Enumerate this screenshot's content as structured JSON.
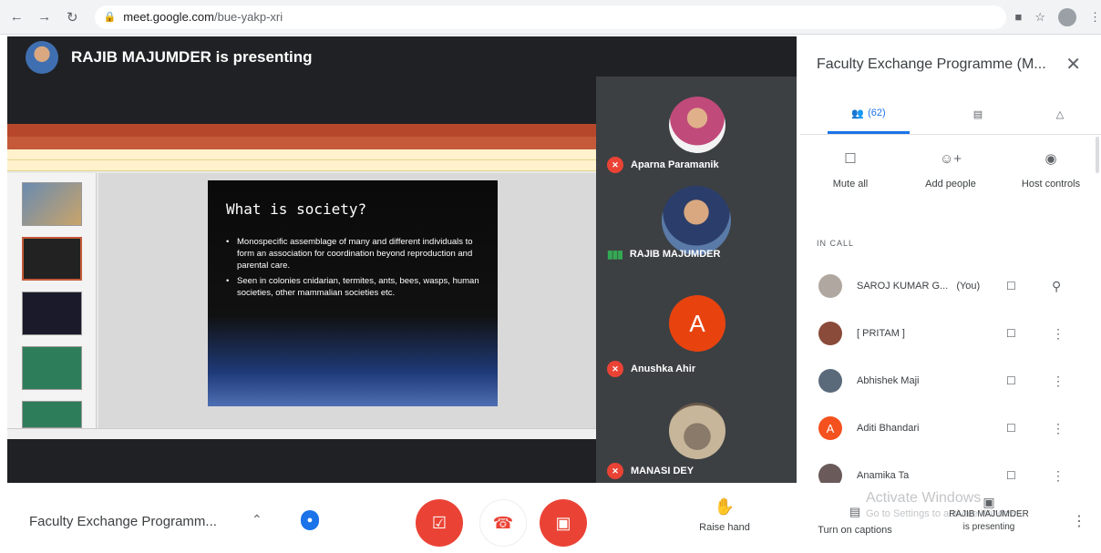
{
  "browser": {
    "url_domain": "meet.google.com",
    "url_path": "/bue-yakp-xri"
  },
  "banner": {
    "text": "RAJIB MAJUMDER is presenting"
  },
  "slide": {
    "title": "What is society?",
    "bullets": [
      "Monospecific assemblage of many and different individuals to form an association for coordination beyond reproduction and parental care.",
      "Seen in colonies cnidarian, termites, ants, bees, wasps, human societies, other mammalian societies etc."
    ]
  },
  "tiles": [
    {
      "name": "Aparna Paramanik",
      "muted": true
    },
    {
      "name": "RAJIB MAJUMDER",
      "muted": false
    },
    {
      "name": "Anushka Ahir",
      "muted": true,
      "initial": "A"
    },
    {
      "name": "MANASI DEY",
      "muted": true
    }
  ],
  "panel": {
    "title": "Faculty Exchange Programme (M...",
    "people_count": "(62)",
    "actions": {
      "mute_all": "Mute all",
      "add_people": "Add people",
      "host_controls": "Host controls"
    },
    "section_label": "IN CALL",
    "participants": [
      {
        "name": "SAROJ KUMAR G...",
        "suffix": "(You)",
        "color": "#b0a8a0"
      },
      {
        "name": "[ PRITAM ]",
        "color": "#8a4b3a"
      },
      {
        "name": "Abhishek Maji",
        "color": "#5a6a7a"
      },
      {
        "name": "Aditi Bhandari",
        "color": "#f4511e",
        "initial": "A"
      },
      {
        "name": "Anamika Ta",
        "color": "#6a5a5a"
      }
    ]
  },
  "bottom": {
    "meeting_name": "Faculty Exchange Programm...",
    "raise_hand": "Raise hand",
    "captions": "Turn on captions",
    "activate_title": "Activate Windows",
    "activate_sub": "Go to Settings to activate Windows.",
    "presenter_line1": "RAJIB MAJUMDER",
    "presenter_line2": "is presenting"
  },
  "colors": {
    "accent": "#1a73e8",
    "danger": "#ea4335",
    "stage_bg": "#202124"
  }
}
